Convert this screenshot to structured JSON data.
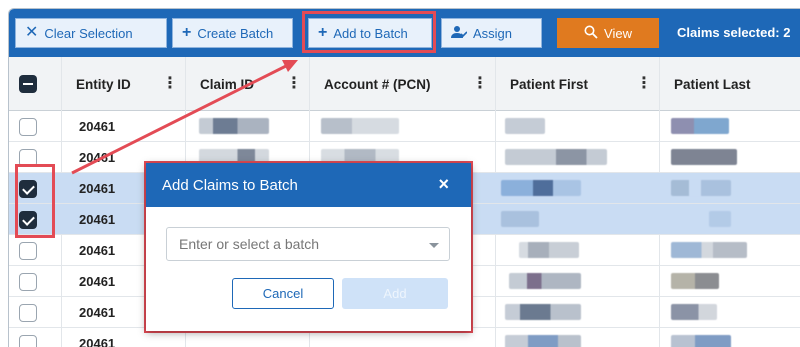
{
  "toolbar": {
    "clear_selection": "Clear Selection",
    "create_batch": "Create Batch",
    "add_to_batch": "Add to Batch",
    "assign": "Assign",
    "view": "View",
    "claims_selected": "Claims selected: 2"
  },
  "table": {
    "columns": [
      "Entity ID",
      "Claim ID",
      "Account # (PCN)",
      "Patient First",
      "Patient Last"
    ],
    "rows": [
      {
        "entity_id": "20461",
        "selected": false
      },
      {
        "entity_id": "20461",
        "selected": false
      },
      {
        "entity_id": "20461",
        "selected": true
      },
      {
        "entity_id": "20461",
        "selected": true
      },
      {
        "entity_id": "20461",
        "selected": false
      },
      {
        "entity_id": "20461",
        "selected": false
      },
      {
        "entity_id": "20461",
        "selected": false
      },
      {
        "entity_id": "20461",
        "selected": false
      }
    ]
  },
  "modal": {
    "title": "Add Claims to Batch",
    "close": "×",
    "batch_placeholder": "Enter or select a batch",
    "cancel": "Cancel",
    "add": "Add"
  },
  "colors": {
    "primary": "#1e68b7",
    "view_button": "#e07a1f",
    "highlight": "#e34b55",
    "selected_row": "#c9dcf3"
  },
  "icons": {
    "clear": "close-icon",
    "create": "plus-icon",
    "add": "plus-icon",
    "assign": "assign-user-icon",
    "view": "search-icon"
  }
}
